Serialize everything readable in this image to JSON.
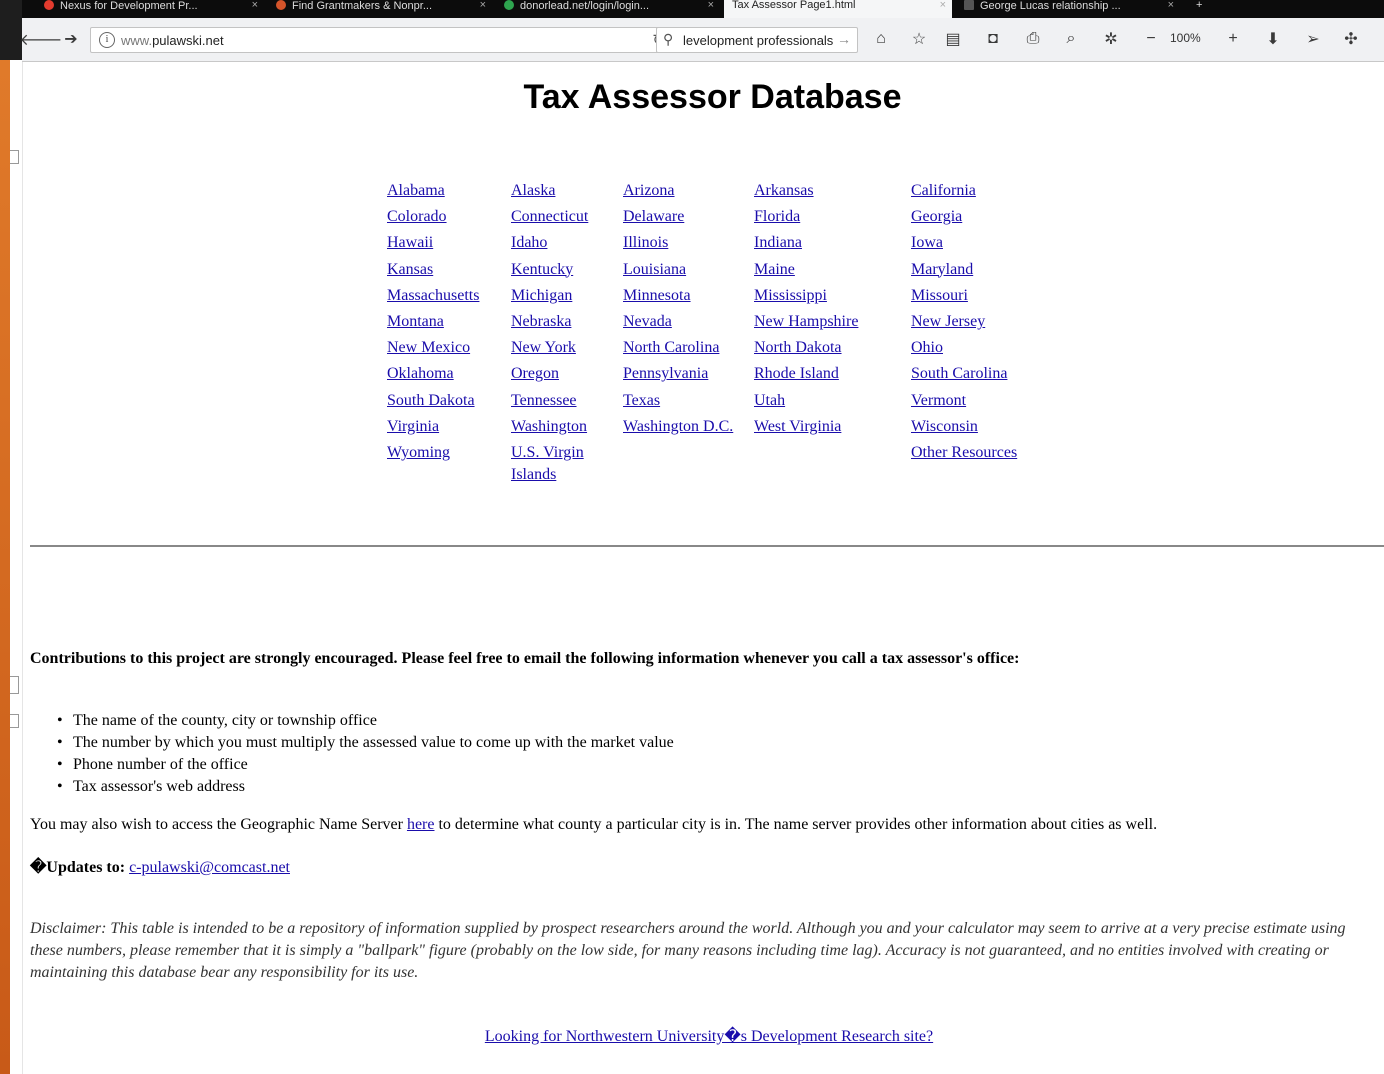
{
  "tabs": [
    {
      "label": "Nexus for Development Pr...",
      "favicon_color": "#e33b2e"
    },
    {
      "label": "Find Grantmakers & Nonpr...",
      "favicon_color": "#d4542a"
    },
    {
      "label": "donorlead.net/login/login...",
      "favicon_color": "#2ea44f"
    },
    {
      "label": "Tax Assessor Page1.html",
      "favicon_color": "#888888"
    },
    {
      "label": "George Lucas relationship ...",
      "favicon_color": "#555555"
    }
  ],
  "toolbar": {
    "url_prefix": "www.",
    "url_domain": "pulawski.net",
    "search_text": "levelopment professionals",
    "zoom": "100%"
  },
  "page": {
    "title": "Tax Assessor Database",
    "states": [
      [
        "Alabama",
        "Alaska",
        "Arizona",
        "Arkansas",
        "California"
      ],
      [
        "Colorado",
        "Connecticut",
        "Delaware",
        "Florida",
        "Georgia"
      ],
      [
        "Hawaii",
        "Idaho",
        "Illinois",
        "Indiana",
        "Iowa"
      ],
      [
        "Kansas",
        "Kentucky",
        "Louisiana",
        "Maine",
        "Maryland"
      ],
      [
        "Massachusetts",
        "Michigan",
        "Minnesota",
        "Mississippi",
        "Missouri"
      ],
      [
        "Montana",
        "Nebraska",
        "Nevada",
        "New Hampshire",
        "New Jersey"
      ],
      [
        "New Mexico",
        "New York",
        "North Carolina",
        "North Dakota",
        "Ohio"
      ],
      [
        "Oklahoma",
        "Oregon",
        "Pennsylvania",
        "Rhode Island",
        "South Carolina"
      ],
      [
        "South Dakota",
        "Tennessee",
        "Texas",
        "Utah",
        "Vermont"
      ],
      [
        "Virginia",
        "Washington",
        "Washington D.C.",
        "West Virginia",
        "Wisconsin"
      ],
      [
        "Wyoming",
        "U.S. Virgin Islands",
        "",
        "",
        "Other Resources"
      ]
    ],
    "contrib_text": "Contributions to this project are strongly encouraged. Please feel free to email the following information whenever you call a tax assessor's office:",
    "bullets": [
      "The name of the county, city or township office",
      "The number by which you must multiply the assessed value to come up with the market value",
      "Phone number of the office",
      "Tax assessor's web address"
    ],
    "gns_before": "You may also wish to access the Geographic Name Server ",
    "gns_link": "here",
    "gns_after": " to determine what county a particular city is in. The name server provides other information about cities as well.",
    "updates_label": "�Updates to:",
    "updates_email": "c-pulawski@comcast.net",
    "disclaimer": "Disclaimer: This table is intended to be a repository of information supplied by prospect researchers around the world. Although you and your calculator may seem to arrive at a very precise estimate using these numbers, please remember that it is simply a \"ballpark\" figure (probably on the low side, for many reasons including time lag). Accuracy is not guaranteed, and no entities involved with creating or maintaining this database bear any responsibility for its use.",
    "nwu_link": "Looking for Northwestern University�s Development Research site?"
  }
}
